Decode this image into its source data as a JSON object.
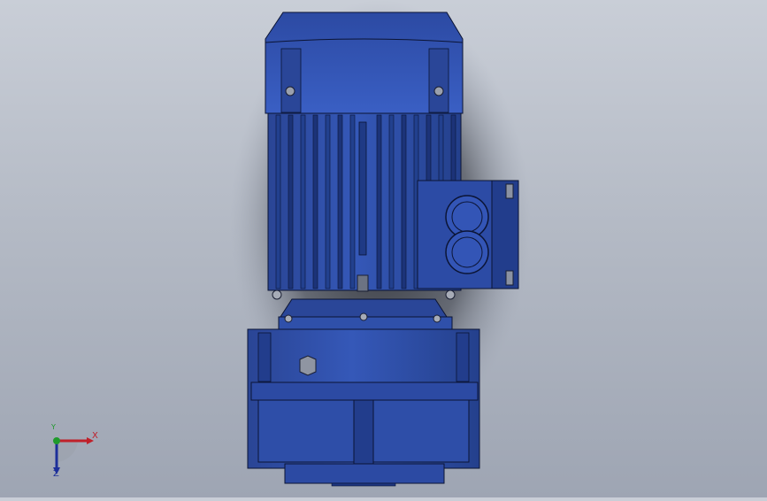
{
  "viewport": {
    "background_top": "#c9ced7",
    "background_bottom": "#9ea5b3",
    "model_color": "#2f4fa6",
    "model_dark": "#1d3580",
    "model_light": "#4f74cf",
    "edge_color": "#0b1434"
  },
  "model": {
    "name": "",
    "parts": [
      "motor-fan-cover",
      "motor-housing",
      "terminal-box",
      "flange-adapter",
      "gearbox-housing",
      "output-shaft-collar"
    ]
  },
  "triad": {
    "x_label": "X",
    "y_label": "Y",
    "z_label": "Z",
    "x_color": "#c0202a",
    "y_color": "#1f9a2c",
    "z_color": "#1d2f9a"
  }
}
